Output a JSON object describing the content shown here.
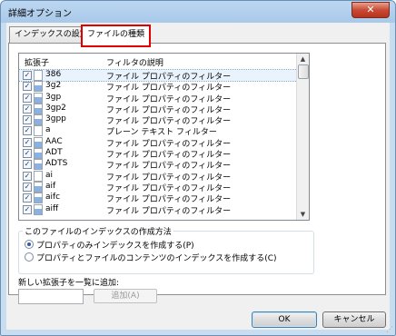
{
  "window": {
    "title": "詳細オプション",
    "close_label": "✕"
  },
  "tabs": [
    {
      "label": "インデックスの設定"
    },
    {
      "label": "ファイルの種類"
    }
  ],
  "list": {
    "headers": [
      "拡張子",
      "フィルタの説明"
    ],
    "rows": [
      {
        "ext": "386",
        "desc": "ファイル プロパティのフィルター",
        "checked": true,
        "icon": "system-file-icon",
        "selected": true
      },
      {
        "ext": "3g2",
        "desc": "ファイル プロパティのフィルター",
        "checked": true,
        "icon": "media-file-icon",
        "selected": false
      },
      {
        "ext": "3gp",
        "desc": "ファイル プロパティのフィルター",
        "checked": true,
        "icon": "media-file-icon",
        "selected": false
      },
      {
        "ext": "3gp2",
        "desc": "ファイル プロパティのフィルター",
        "checked": true,
        "icon": "media-file-icon",
        "selected": false
      },
      {
        "ext": "3gpp",
        "desc": "ファイル プロパティのフィルター",
        "checked": true,
        "icon": "media-file-icon",
        "selected": false
      },
      {
        "ext": "a",
        "desc": "プレーン テキスト フィルター",
        "checked": true,
        "icon": "blank-file-icon",
        "selected": false
      },
      {
        "ext": "AAC",
        "desc": "ファイル プロパティのフィルター",
        "checked": true,
        "icon": "media-file-icon",
        "selected": false
      },
      {
        "ext": "ADT",
        "desc": "ファイル プロパティのフィルター",
        "checked": true,
        "icon": "media-file-icon",
        "selected": false
      },
      {
        "ext": "ADTS",
        "desc": "ファイル プロパティのフィルター",
        "checked": true,
        "icon": "media-file-icon",
        "selected": false
      },
      {
        "ext": "ai",
        "desc": "ファイル プロパティのフィルター",
        "checked": true,
        "icon": "blank-file-icon",
        "selected": false
      },
      {
        "ext": "aif",
        "desc": "ファイル プロパティのフィルター",
        "checked": true,
        "icon": "media-file-icon",
        "selected": false
      },
      {
        "ext": "aifc",
        "desc": "ファイル プロパティのフィルター",
        "checked": true,
        "icon": "media-file-icon",
        "selected": false
      },
      {
        "ext": "aiff",
        "desc": "ファイル プロパティのフィルター",
        "checked": true,
        "icon": "media-file-icon",
        "selected": false
      }
    ]
  },
  "index_method": {
    "title": "このファイルのインデックスの作成方法",
    "options": [
      {
        "label": "プロパティのみインデックスを作成する(P)",
        "selected": true
      },
      {
        "label": "プロパティとファイルのコンテンツのインデックスを作成する(C)",
        "selected": false
      }
    ]
  },
  "add_extension": {
    "label": "新しい拡張子を一覧に追加:",
    "input_value": "",
    "button_label": "追加(A)"
  },
  "buttons": {
    "ok": "OK",
    "cancel": "キャンセル"
  },
  "colors": {
    "highlight_border": "#e00000",
    "title_bar": "#a9c9ea"
  }
}
